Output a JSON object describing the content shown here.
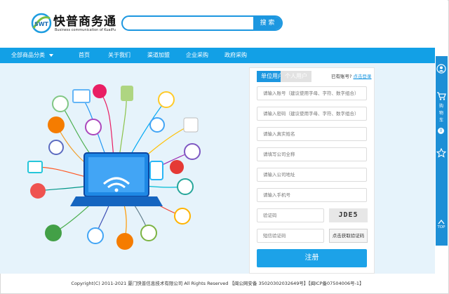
{
  "logo": {
    "badge": "SWT",
    "title": "快普商务通",
    "subtitle": "Business communication of KuaiPu"
  },
  "search": {
    "placeholder": "",
    "button_label": "搜 索"
  },
  "nav": {
    "all_categories": "全部商品分类",
    "items": [
      "首页",
      "关于我们",
      "渠道加盟",
      "企业采购",
      "政府采购"
    ]
  },
  "form": {
    "tabs": [
      "单位用户",
      "个人用户"
    ],
    "have_account": "已有账号?",
    "login_link": "点击登录",
    "fields": {
      "account": "请输入账号（建议使用字母、字符、数字组合）",
      "password": "请输入密码（建议使用字母、字符、数字组合）",
      "real_name": "请输入真实姓名",
      "company": "请填写公司全称",
      "address": "请输入公司地址",
      "phone": "请输入手机号",
      "captcha": "验证码",
      "sms_code": "短信验证码"
    },
    "captcha_image_text": "JDE5",
    "sms_button": "点击获取验证码",
    "register_button": "注册"
  },
  "footer": {
    "text": "Copyright(C) 2011-2021 厦门快普信息技术有限公司 All Rights Reserved 【闽公网安备 35020302032649号】【闽ICP备07504006号-1】"
  },
  "sidebar": {
    "cart_label_lines": [
      "购",
      "物",
      "车"
    ],
    "cart_count": "0",
    "top_label": "TOP"
  },
  "colors": {
    "accent": "#1c97e0",
    "nav_bg": "#12a0e6",
    "hero_bg": "#e6f3fb",
    "sidebar": "#1d8fd6"
  }
}
